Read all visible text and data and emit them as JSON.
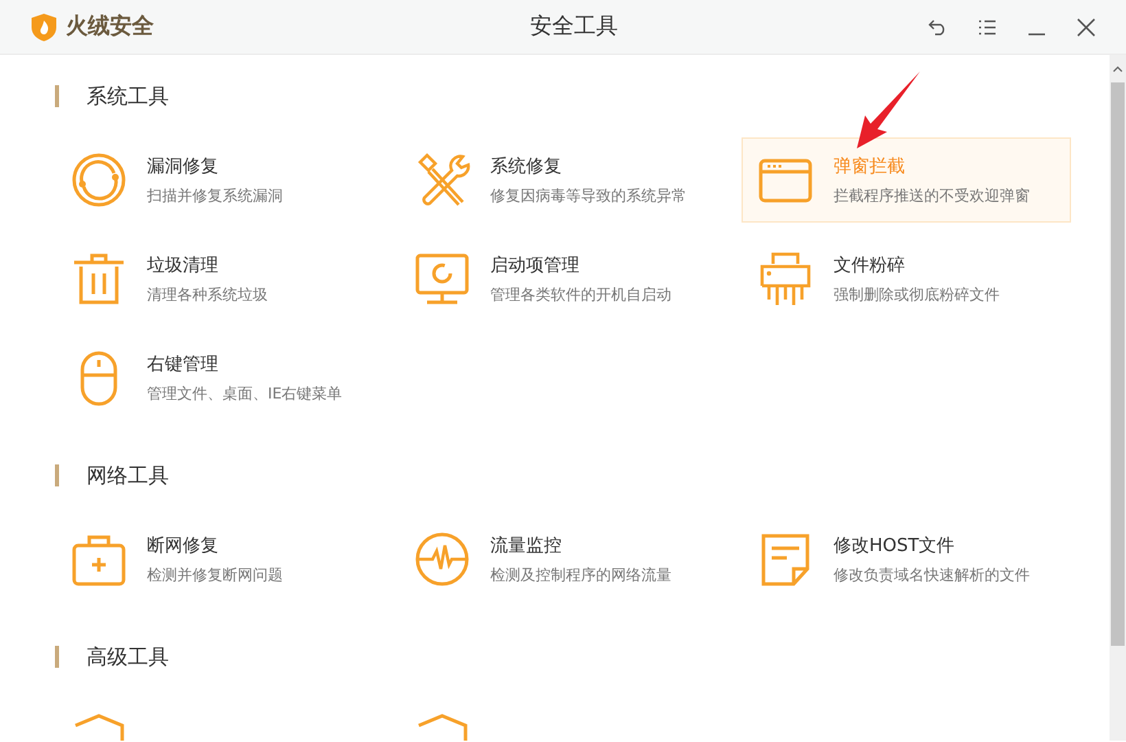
{
  "window": {
    "app_name": "火绒安全",
    "title": "安全工具"
  },
  "sections": [
    {
      "title": "系统工具",
      "items": [
        {
          "kind": "bug-repair",
          "title": "漏洞修复",
          "desc": "扫描并修复系统漏洞",
          "selected": false
        },
        {
          "kind": "tools",
          "title": "系统修复",
          "desc": "修复因病毒等导致的系统异常",
          "selected": false
        },
        {
          "kind": "popup",
          "title": "弹窗拦截",
          "desc": "拦截程序推送的不受欢迎弹窗",
          "selected": true
        },
        {
          "kind": "trash",
          "title": "垃圾清理",
          "desc": "清理各种系统垃圾",
          "selected": false
        },
        {
          "kind": "monitor",
          "title": "启动项管理",
          "desc": "管理各类软件的开机自启动",
          "selected": false
        },
        {
          "kind": "shredder",
          "title": "文件粉碎",
          "desc": "强制删除或彻底粉碎文件",
          "selected": false
        },
        {
          "kind": "mouse",
          "title": "右键管理",
          "desc": "管理文件、桌面、IE右键菜单",
          "selected": false
        }
      ]
    },
    {
      "title": "网络工具",
      "items": [
        {
          "kind": "kit",
          "title": "断网修复",
          "desc": "检测并修复断网问题",
          "selected": false
        },
        {
          "kind": "pulse",
          "title": "流量监控",
          "desc": "检测及控制程序的网络流量",
          "selected": false
        },
        {
          "kind": "note",
          "title": "修改HOST文件",
          "desc": "修改负责域名快速解析的文件",
          "selected": false
        }
      ]
    },
    {
      "title": "高级工具",
      "items": [
        {
          "kind": "shield",
          "selected": false
        },
        {
          "kind": "shield",
          "selected": false
        }
      ]
    }
  ]
}
